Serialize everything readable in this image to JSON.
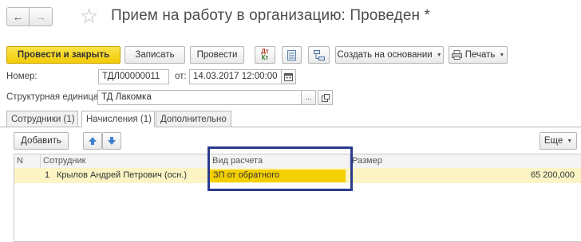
{
  "window": {
    "title": "Прием на работу в организацию: Проведен *"
  },
  "toolbar": {
    "post_and_close": "Провести и закрыть",
    "save": "Записать",
    "post": "Провести",
    "create_based_on": "Создать на основании",
    "print": "Печать",
    "dtkt_icon_top": "Дт",
    "dtkt_icon_bottom": "Кт"
  },
  "form": {
    "number_label": "Номер:",
    "number_value": "ТДЛ00000011",
    "date_label": "от:",
    "date_value": "14.03.2017 12:00:00",
    "unit_label": "Структурная единица:",
    "unit_value": "ТД Лакомка",
    "select_button": "..."
  },
  "tabs": [
    {
      "label": "Сотрудники (1)",
      "active": false
    },
    {
      "label": "Начисления (1)",
      "active": true
    },
    {
      "label": "Дополнительно",
      "active": false
    }
  ],
  "table_toolbar": {
    "add": "Добавить",
    "more": "Еще"
  },
  "table": {
    "columns": [
      "N",
      "Сотрудник",
      "Вид расчета",
      "Размер"
    ],
    "rows": [
      {
        "n": "1",
        "employee": "Крылов Андрей Петрович (осн.)",
        "calc_type": "ЗП от обратного",
        "amount": "65 200,000"
      }
    ]
  },
  "colors": {
    "primary_button": "#f3cb06",
    "selected_row": "#fcf4c4",
    "selected_cell": "#f5d000",
    "highlight_frame": "#2c3a8c"
  }
}
